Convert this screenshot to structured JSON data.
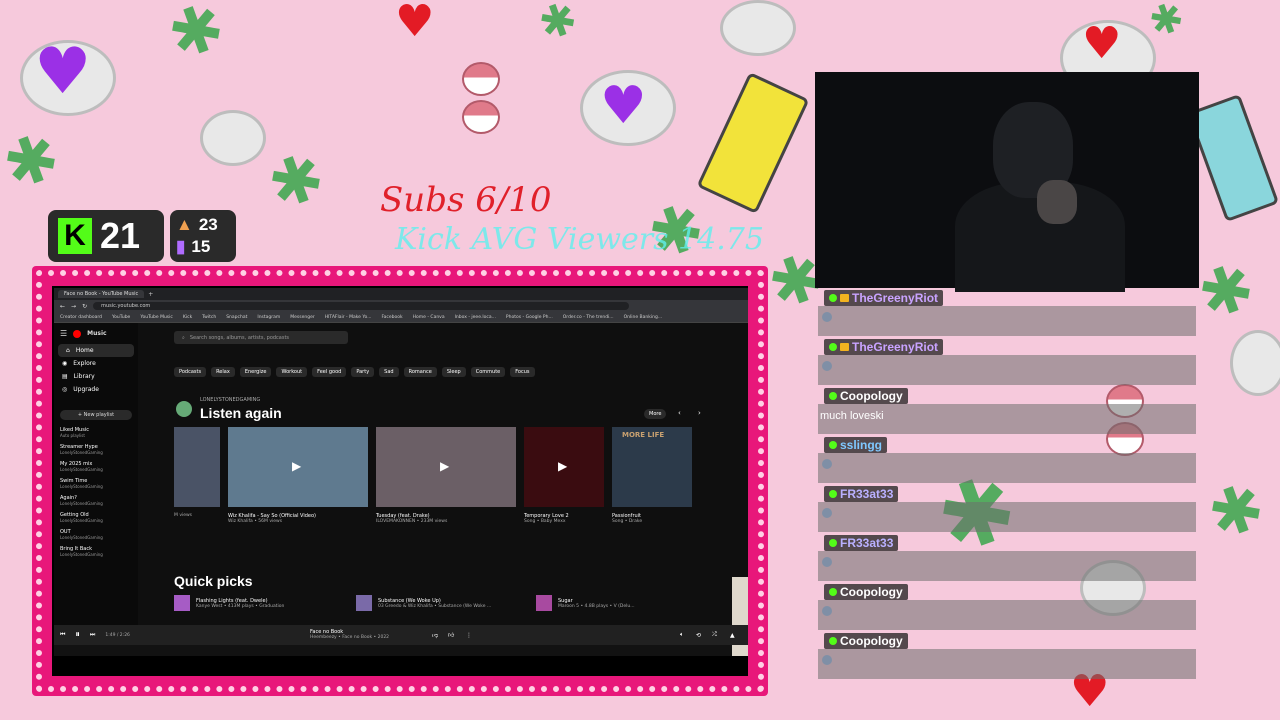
{
  "overlay": {
    "subs_text": "Subs 6/10",
    "kick_avg_text": "Kick AVG Viewers 14.75",
    "kick_count": "21",
    "stat_followers": "23",
    "stat_viewers": "15",
    "colors": {
      "kick_green": "#53fc18",
      "subs_red": "#e0202a",
      "avg_cyan": "#5ff0ee",
      "frame_pink": "#e8177a",
      "bg_pink": "#f6c9dc"
    }
  },
  "browser": {
    "tab_label": "Face no Book - YouTube Music",
    "url": "music.youtube.com",
    "bookmarks": [
      "Creator dashboard",
      "YouTube",
      "YouTube Music",
      "Kick",
      "Twitch",
      "Snapchat",
      "Instagram",
      "Messenger",
      "HITAFlair - Make Yo...",
      "Facebook",
      "Home - Canva",
      "Inbox - jeee.loca...",
      "Photos - Google Ph...",
      "Order.co - The trendi...",
      "Online Banking..."
    ]
  },
  "ytm": {
    "logo": "Music",
    "nav": [
      {
        "label": "Home",
        "icon": "home-icon"
      },
      {
        "label": "Explore",
        "icon": "explore-icon"
      },
      {
        "label": "Library",
        "icon": "library-icon"
      },
      {
        "label": "Upgrade",
        "icon": "upgrade-icon"
      }
    ],
    "new_playlist": "New playlist",
    "playlists": [
      {
        "name": "Liked Music",
        "sub": "Auto playlist"
      },
      {
        "name": "Streamer Hype",
        "sub": "LonelyStonedGaming"
      },
      {
        "name": "My 2025 mix",
        "sub": "LonelyStonedGaming"
      },
      {
        "name": "Swim Time",
        "sub": "LonelyStonedGaming"
      },
      {
        "name": "Again?",
        "sub": "LonelyStonedGaming"
      },
      {
        "name": "Getting Old",
        "sub": "LonelyStonedGaming"
      },
      {
        "name": "OUT",
        "sub": "LonelyStonedGaming"
      },
      {
        "name": "Bring It Back",
        "sub": "LonelyStonedGaming"
      }
    ],
    "search_placeholder": "Search songs, albums, artists, podcasts",
    "chips": [
      "Podcasts",
      "Relax",
      "Energize",
      "Workout",
      "Feel good",
      "Party",
      "Sad",
      "Romance",
      "Sleep",
      "Commute",
      "Focus"
    ],
    "section_owner": "LONELYSTONEDGAMING",
    "section_title": "Listen again",
    "more": "More",
    "cards": [
      {
        "title": "",
        "sub": "M views"
      },
      {
        "title": "Wiz Khalifa - Say So (Official Video)",
        "sub": "Wiz Khalifa • 56M views"
      },
      {
        "title": "Tuesday (feat. Drake)",
        "sub": "ILOVEMAKONNEN • 233M views"
      },
      {
        "title": "Temporary Love 2",
        "sub": "Song • Baby Mexx"
      },
      {
        "title": "Passionfruit",
        "sub": "Song • Drake"
      }
    ],
    "album_art_text": "MORE LIFE",
    "quick_picks_title": "Quick picks",
    "quick_picks": [
      {
        "title": "Flashing Lights (feat. Dwele)",
        "sub": "Kanye West • 413M plays • Graduation"
      },
      {
        "title": "Substance (We Woke Up)",
        "sub": "03 Greedo & Wiz Khalifa • Substance (We Woke ..."
      },
      {
        "title": "Sugar",
        "sub": "Maroon 5 • 4.8B plays • V (Delu..."
      }
    ],
    "player": {
      "time": "1:49 / 2:26",
      "track": "Face no Book",
      "artist": "Heembeezy • Face no Book • 2022"
    }
  },
  "chat": [
    {
      "user": "TheGreenyRiot",
      "color": "#c9a3ff",
      "crown": true,
      "msg": ""
    },
    {
      "user": "TheGreenyRiot",
      "color": "#c9a3ff",
      "crown": true,
      "msg": ""
    },
    {
      "user": "Coopology",
      "color": "#ffffff",
      "crown": false,
      "msg": "much loveski"
    },
    {
      "user": "sslingg",
      "color": "#7fc8ff",
      "crown": false,
      "msg": ""
    },
    {
      "user": "FR33at33",
      "color": "#b9b0ff",
      "crown": false,
      "msg": ""
    },
    {
      "user": "FR33at33",
      "color": "#b9b0ff",
      "crown": false,
      "msg": ""
    },
    {
      "user": "Coopology",
      "color": "#ffffff",
      "crown": false,
      "msg": ""
    },
    {
      "user": "Coopology",
      "color": "#ffffff",
      "crown": false,
      "msg": ""
    }
  ]
}
